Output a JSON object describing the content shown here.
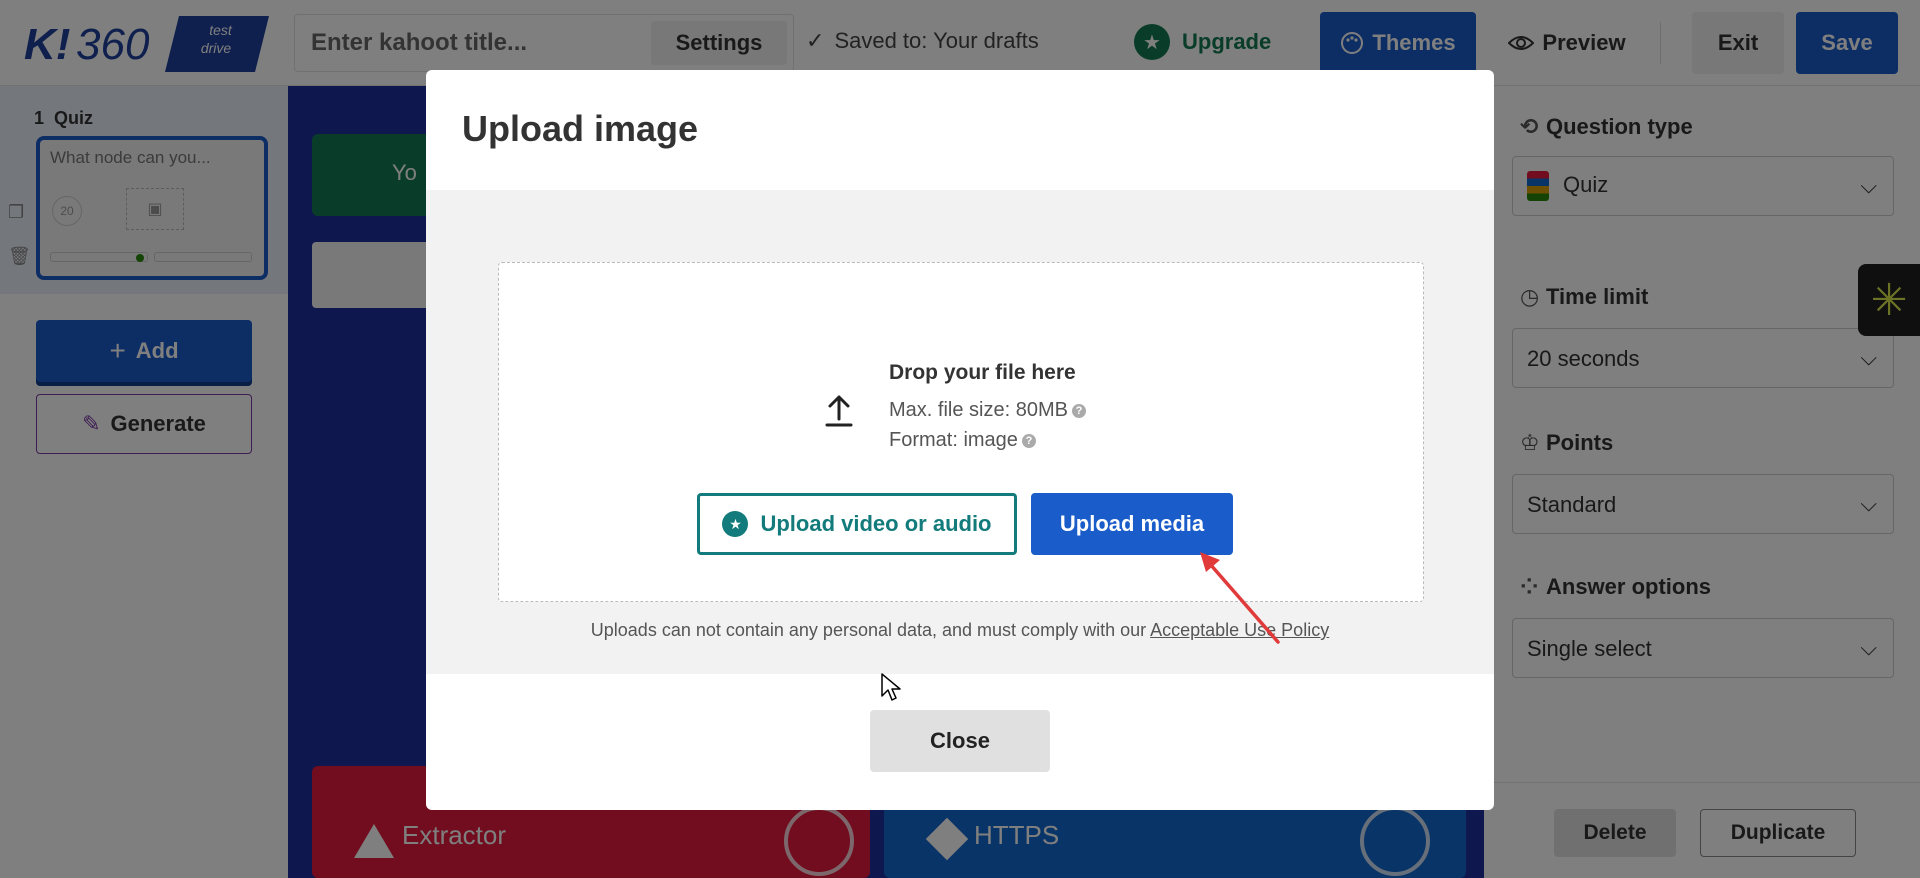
{
  "topbar": {
    "logo_k": "K!",
    "logo_360": "360",
    "logo_tag_line1": "test",
    "logo_tag_line2": "drive",
    "title_placeholder": "Enter kahoot title...",
    "settings_label": "Settings",
    "saved_label": "Saved to: Your drafts",
    "upgrade_label": "Upgrade",
    "themes_label": "Themes",
    "preview_label": "Preview",
    "exit_label": "Exit",
    "save_label": "Save"
  },
  "left_panel": {
    "slide_number": "1",
    "slide_type": "Quiz",
    "slide_question": "What node can you...",
    "slide_timer": "20",
    "add_label": "Add",
    "generate_label": "Generate"
  },
  "canvas": {
    "banner_text": "Yo",
    "answers": [
      {
        "label": "Extractor",
        "color": "#e21b3c",
        "shape": "triangle-icon"
      },
      {
        "label": "HTTPS",
        "color": "#1368ce",
        "shape": "diamond-icon"
      }
    ]
  },
  "right_panel": {
    "question_type_heading": "Question type",
    "question_type_value": "Quiz",
    "time_limit_heading": "Time limit",
    "time_limit_value": "20 seconds",
    "points_heading": "Points",
    "points_value": "Standard",
    "answer_options_heading": "Answer options",
    "answer_options_value": "Single select",
    "delete_label": "Delete",
    "duplicate_label": "Duplicate"
  },
  "modal": {
    "title": "Upload image",
    "drop_title": "Drop your file here",
    "max_size": "Max. file size: 80MB",
    "format": "Format: image",
    "upload_video_label": "Upload video or audio",
    "upload_media_label": "Upload media",
    "policy_text": "Uploads can not contain any personal data, and must comply with our ",
    "policy_link": "Acceptable Use Policy",
    "close_label": "Close"
  },
  "colors": {
    "primary_blue": "#1a5cc9",
    "kahoot_green": "#137b55",
    "teal": "#137b7b",
    "annotation_red": "#e03a3a"
  }
}
